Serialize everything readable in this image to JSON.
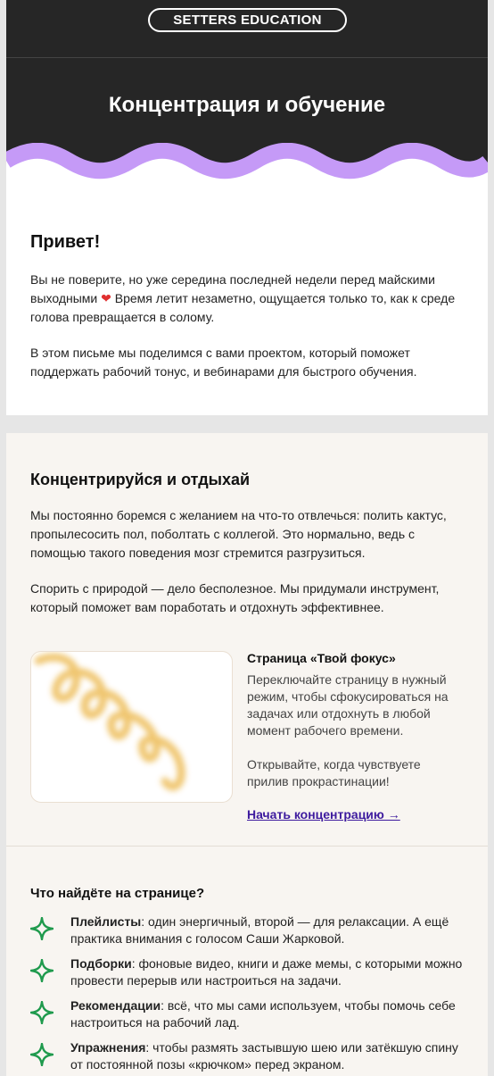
{
  "header": {
    "logo": "SETTERS EDUCATION",
    "title": "Концентрация и обучение"
  },
  "intro": {
    "greeting": "Привет!",
    "p1_a": "Вы не поверите, но уже середина последней недели перед майскими выходными",
    "p1_b": "Время летит незаметно, ощущается только то, как к среде голова превращается в солому.",
    "p2": "В этом письме мы поделимся с вами проектом, который поможет поддержать рабочий тонус, и вебинарами для быстрого обучения."
  },
  "focus": {
    "title": "Концентрируйся и отдыхай",
    "p1": "Мы постоянно боремся с желанием на что-то отвлечься: полить кактус, пропылесосить пол, поболтать с коллегой. Это нормально, ведь с помощью такого поведения мозг стремится разгрузиться.",
    "p2": "Спорить с природой — дело бесполезное. Мы придумали инструмент, который поможет вам поработать и отдохнуть эффективнее.",
    "feature": {
      "title": "Страница «Твой фокус»",
      "p1": "Переключайте страницу в нужный режим, чтобы сфокусироваться на задачах или отдохнуть в любой момент рабочего времени.",
      "p2": "Открывайте, когда чувствуете прилив прокрастинации!",
      "link": "Начать концентрацию →"
    }
  },
  "findings": {
    "title": "Что найдёте на странице?",
    "items": [
      {
        "bold": "Плейлисты",
        "text": ": один энергичный, второй — для релаксации. А ещё практика внимания с голосом Саши Жарковой."
      },
      {
        "bold": "Подборки",
        "text": ": фоновые видео, книги и даже мемы, с которыми можно провести перерыв или настроиться на задачи."
      },
      {
        "bold": "Рекомендации",
        "text": ": всё, что мы сами используем, чтобы помочь себе настроиться на рабочий лад."
      },
      {
        "bold": "Упражнения",
        "text": ": чтобы размять застывшую шею или затёкшую спину от постоянной позы «крючком» перед экраном."
      }
    ]
  },
  "colors": {
    "header_bg": "#262626",
    "wave": "#c59af7",
    "link": "#3d1a9e",
    "star": "#1f9a4d",
    "heart": "#e03030"
  }
}
